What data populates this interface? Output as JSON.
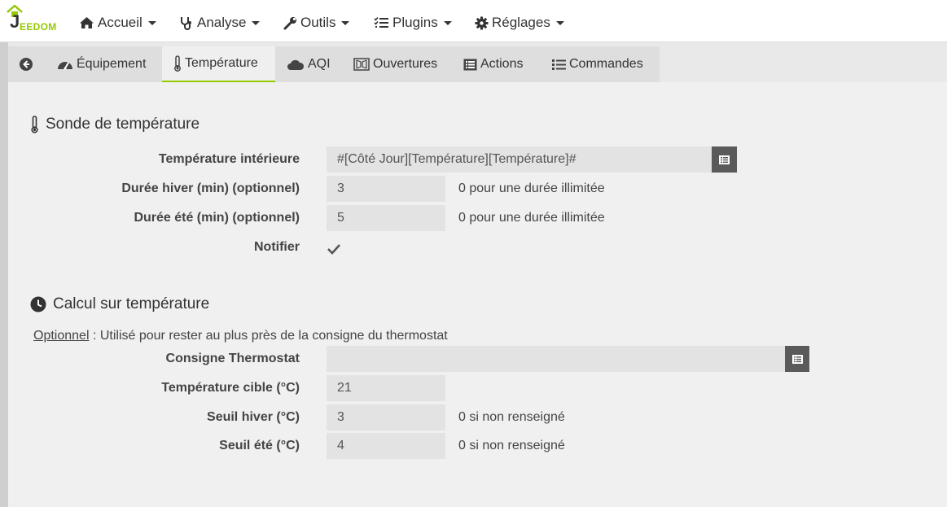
{
  "app": {
    "logo_text": "EEDOM",
    "logo_j": "J"
  },
  "navbar": {
    "items": [
      {
        "label": "Accueil",
        "icon": "home-icon"
      },
      {
        "label": "Analyse",
        "icon": "stethoscope-icon"
      },
      {
        "label": "Outils",
        "icon": "wrench-icon"
      },
      {
        "label": "Plugins",
        "icon": "tasks-icon"
      },
      {
        "label": "Réglages",
        "icon": "gear-icon"
      }
    ]
  },
  "tabs": [
    {
      "label": "",
      "icon": "back-arrow-icon"
    },
    {
      "label": "Équipement",
      "icon": "tachometer-icon"
    },
    {
      "label": "Température",
      "icon": "thermometer-icon",
      "active": true
    },
    {
      "label": "AQI",
      "icon": "cloud-icon"
    },
    {
      "label": "Ouvertures",
      "icon": "window-icon"
    },
    {
      "label": "Actions",
      "icon": "list-alt-icon"
    },
    {
      "label": "Commandes",
      "icon": "list-icon"
    }
  ],
  "sonde": {
    "title": "Sonde de température",
    "interior_label": "Température intérieure",
    "interior_value": "#[Côté Jour][Température][Température]#",
    "winter_label": "Durée hiver (min) (optionnel)",
    "winter_value": "3",
    "winter_help": "0 pour une durée illimitée",
    "summer_label": "Durée été (min) (optionnel)",
    "summer_value": "5",
    "summer_help": "0 pour une durée illimitée",
    "notify_label": "Notifier",
    "notify_checked": true
  },
  "calcul": {
    "title": "Calcul sur température",
    "note_prefix": "Optionnel",
    "note_text": " : Utilisé pour rester au plus près de la consigne du thermostat",
    "consigne_label": "Consigne Thermostat",
    "consigne_value": "",
    "target_label": "Température cible (°C)",
    "target_value": "21",
    "winter_label": "Seuil hiver (°C)",
    "winter_value": "3",
    "winter_help": "0 si non renseigné",
    "summer_label": "Seuil été (°C)",
    "summer_value": "4",
    "summer_help": "0 si non renseigné"
  },
  "colors": {
    "accent": "#94ca02",
    "button": "#5a5a5a",
    "field": "#e3e3e3"
  }
}
